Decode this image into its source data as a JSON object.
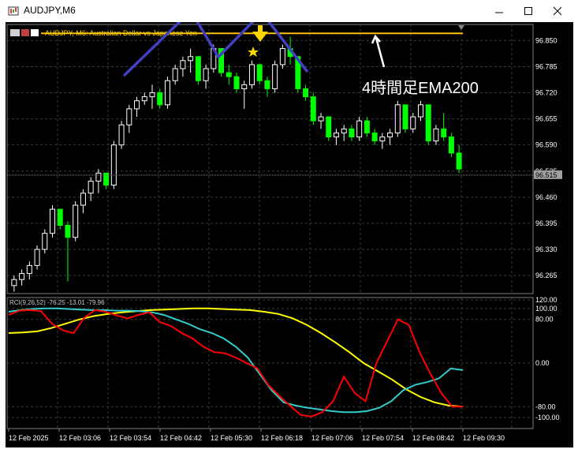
{
  "window": {
    "title": "AUDJPY,M6",
    "minimize_icon": "minimize-icon",
    "maximize_icon": "maximize-icon",
    "close_icon": "close-icon"
  },
  "chart": {
    "header_text": "AUDJPY, M6:  Australian Dollar vs Japanese Yen",
    "annotation": "4時間足EMA200",
    "current_price": "96.515",
    "colors": {
      "background": "#000000",
      "grid": "#3a3a3a",
      "bull_candle": "#ffffff",
      "bear_candle": "#00ff00",
      "ema200": "#ffc000",
      "pattern": "#4040c0",
      "arrow": "#ffd700",
      "rci_short": "#ff0000",
      "rci_mid": "#33cccc",
      "rci_long": "#ffff00"
    },
    "price_axis": [
      "96.850",
      "96.785",
      "96.720",
      "96.655",
      "96.590",
      "96.525",
      "96.460",
      "96.395",
      "96.330",
      "96.265"
    ],
    "time_axis": [
      "12 Feb 2025",
      "12 Feb 03:06",
      "12 Feb 03:54",
      "12 Feb 04:42",
      "12 Feb 05:30",
      "12 Feb 06:18",
      "12 Feb 07:06",
      "12 Feb 07:54",
      "12 Feb 08:42",
      "12 Feb 09:30"
    ]
  },
  "indicator": {
    "label": "RCI(9,26,52) -76.25 -13.01 -79.96",
    "axis": [
      "120.00",
      "100.00",
      "80.00",
      "0.00",
      "-80.00",
      "-100.00"
    ]
  },
  "chart_data": {
    "type": "candlestick",
    "symbol": "AUDJPY",
    "timeframe": "M6",
    "ema200_level": 96.868,
    "last_price": 96.515,
    "ylim": [
      96.22,
      96.89
    ],
    "candles": [
      [
        96.24,
        96.265,
        96.225,
        96.255
      ],
      [
        96.255,
        96.28,
        96.24,
        96.27
      ],
      [
        96.27,
        96.3,
        96.255,
        96.29
      ],
      [
        96.29,
        96.34,
        96.28,
        96.33
      ],
      [
        96.33,
        96.38,
        96.32,
        96.37
      ],
      [
        96.37,
        96.44,
        96.36,
        96.43
      ],
      [
        96.43,
        96.42,
        96.38,
        96.39
      ],
      [
        96.39,
        96.4,
        96.25,
        96.36
      ],
      [
        96.36,
        96.45,
        96.35,
        96.44
      ],
      [
        96.44,
        96.48,
        96.42,
        96.47
      ],
      [
        96.47,
        96.51,
        96.45,
        96.5
      ],
      [
        96.5,
        96.53,
        96.47,
        96.52
      ],
      [
        96.52,
        96.5,
        96.48,
        96.49
      ],
      [
        96.49,
        96.6,
        96.48,
        96.59
      ],
      [
        96.59,
        96.65,
        96.58,
        96.64
      ],
      [
        96.64,
        96.69,
        96.62,
        96.68
      ],
      [
        96.68,
        96.71,
        96.66,
        96.7
      ],
      [
        96.7,
        96.72,
        96.69,
        96.71
      ],
      [
        96.71,
        96.74,
        96.68,
        96.72
      ],
      [
        96.72,
        96.73,
        96.68,
        96.69
      ],
      [
        96.69,
        96.76,
        96.68,
        96.75
      ],
      [
        96.75,
        96.79,
        96.74,
        96.78
      ],
      [
        96.78,
        96.81,
        96.76,
        96.8
      ],
      [
        96.8,
        96.83,
        96.77,
        96.81
      ],
      [
        96.81,
        96.8,
        96.74,
        96.75
      ],
      [
        96.75,
        96.79,
        96.73,
        96.78
      ],
      [
        96.78,
        96.84,
        96.77,
        96.83
      ],
      [
        96.83,
        96.82,
        96.76,
        96.77
      ],
      [
        96.77,
        96.79,
        96.74,
        96.76
      ],
      [
        96.76,
        96.77,
        96.72,
        96.73
      ],
      [
        96.73,
        96.75,
        96.68,
        96.74
      ],
      [
        96.74,
        96.8,
        96.73,
        96.79
      ],
      [
        96.79,
        96.78,
        96.74,
        96.75
      ],
      [
        96.75,
        96.76,
        96.71,
        96.73
      ],
      [
        96.73,
        96.8,
        96.72,
        96.79
      ],
      [
        96.79,
        96.84,
        96.78,
        96.83
      ],
      [
        96.83,
        96.86,
        96.79,
        96.81
      ],
      [
        96.81,
        96.8,
        96.72,
        96.73
      ],
      [
        96.73,
        96.74,
        96.7,
        96.71
      ],
      [
        96.71,
        96.72,
        96.64,
        96.65
      ],
      [
        96.65,
        96.67,
        96.63,
        96.66
      ],
      [
        96.66,
        96.65,
        96.6,
        96.61
      ],
      [
        96.61,
        96.63,
        96.59,
        96.62
      ],
      [
        96.62,
        96.64,
        96.6,
        96.63
      ],
      [
        96.63,
        96.64,
        96.6,
        96.61
      ],
      [
        96.61,
        96.66,
        96.6,
        96.65
      ],
      [
        96.65,
        96.66,
        96.61,
        96.62
      ],
      [
        96.62,
        96.63,
        96.59,
        96.6
      ],
      [
        96.6,
        96.62,
        96.58,
        96.61
      ],
      [
        96.61,
        96.63,
        96.59,
        96.62
      ],
      [
        96.62,
        96.7,
        96.61,
        96.69
      ],
      [
        96.69,
        96.68,
        96.62,
        96.63
      ],
      [
        96.63,
        96.67,
        96.62,
        96.66
      ],
      [
        96.66,
        96.7,
        96.65,
        96.69
      ],
      [
        96.69,
        96.68,
        96.59,
        96.6
      ],
      [
        96.6,
        96.64,
        96.59,
        96.63
      ],
      [
        96.63,
        96.67,
        96.6,
        96.61
      ],
      [
        96.61,
        96.62,
        96.56,
        96.57
      ],
      [
        96.57,
        96.59,
        96.52,
        96.53
      ]
    ],
    "rci_short": [
      88,
      96,
      97,
      95,
      72,
      60,
      55,
      83,
      97,
      94,
      87,
      82,
      88,
      93,
      75,
      68,
      55,
      45,
      30,
      20,
      18,
      10,
      0,
      -10,
      -40,
      -60,
      -78,
      -95,
      -98,
      -90,
      -70,
      -25,
      -55,
      -70,
      0,
      40,
      80,
      70,
      20,
      -20,
      -55,
      -80,
      -80
    ],
    "rci_mid": [
      94,
      97,
      99,
      100,
      100,
      99,
      98,
      97,
      97,
      96,
      96,
      95,
      93,
      88,
      80,
      72,
      62,
      55,
      45,
      30,
      10,
      -20,
      -50,
      -72,
      -78,
      -82,
      -85,
      -88,
      -90,
      -90,
      -88,
      -82,
      -70,
      -50,
      -40,
      -35,
      -28,
      -10,
      -13
    ],
    "rci_long": [
      55,
      56,
      58,
      64,
      72,
      80,
      86,
      90,
      93,
      95,
      97,
      98,
      99,
      100,
      100,
      99,
      98,
      97,
      94,
      90,
      82,
      70,
      55,
      38,
      20,
      0,
      -15,
      -30,
      -48,
      -62,
      -72,
      -78,
      -80
    ]
  }
}
